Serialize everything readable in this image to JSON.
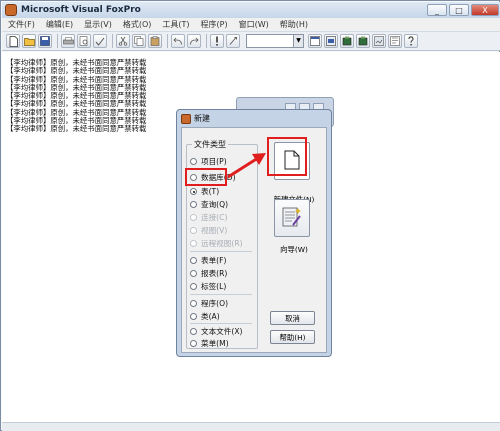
{
  "app": {
    "title": "Microsoft Visual FoxPro"
  },
  "title_buttons": {
    "minimize": "_",
    "maximize": "□",
    "close": "X"
  },
  "menu": [
    "文件(F)",
    "编辑(E)",
    "显示(V)",
    "格式(O)",
    "工具(T)",
    "程序(P)",
    "窗口(W)",
    "帮助(H)"
  ],
  "workspace": {
    "lines": [
      "【李均律师】原创，未经书面同意严禁转载",
      "【李均律师】原创，未经书面同意严禁转载",
      "【李均律师】原创，未经书面同意严禁转载",
      "【李均律师】原创，未经书面同意严禁转载",
      "【李均律师】原创，未经书面同意严禁转载",
      "【李均律师】原创，未经书面同意严禁转载",
      "【李均律师】原创，未经书面同意严禁转载",
      "【李均律师】原创，未经书面同意严禁转载",
      "【李均律师】原创，未经书面同意严禁转载"
    ]
  },
  "dialog": {
    "title": "新建",
    "group_label": "文件类型",
    "radios": [
      {
        "label": "项目(P)",
        "checked": false,
        "disabled": false
      },
      {
        "label": "数据库(D)",
        "checked": false,
        "disabled": false
      },
      {
        "label": "表(T)",
        "checked": true,
        "disabled": false
      },
      {
        "label": "查询(Q)",
        "checked": false,
        "disabled": false
      },
      {
        "label": "连接(C)",
        "checked": false,
        "disabled": true
      },
      {
        "label": "视图(V)",
        "checked": false,
        "disabled": true
      },
      {
        "label": "远程视图(R)",
        "checked": false,
        "disabled": true
      },
      {
        "label": "表单(F)",
        "checked": false,
        "disabled": false
      },
      {
        "label": "报表(R)",
        "checked": false,
        "disabled": false
      },
      {
        "label": "标签(L)",
        "checked": false,
        "disabled": false
      },
      {
        "label": "程序(O)",
        "checked": false,
        "disabled": false
      },
      {
        "label": "类(A)",
        "checked": false,
        "disabled": false
      },
      {
        "label": "文本文件(X)",
        "checked": false,
        "disabled": false
      },
      {
        "label": "菜单(M)",
        "checked": false,
        "disabled": false
      }
    ],
    "new_file_label": "新建文件(N)",
    "wizard_label": "向导(W)",
    "cancel_label": "取消",
    "help_label": "帮助(H)"
  },
  "colors": {
    "annotation": "#e01e1e",
    "titlebar": "#c7d6ea",
    "dialog_frame": "#c4d3e5"
  }
}
